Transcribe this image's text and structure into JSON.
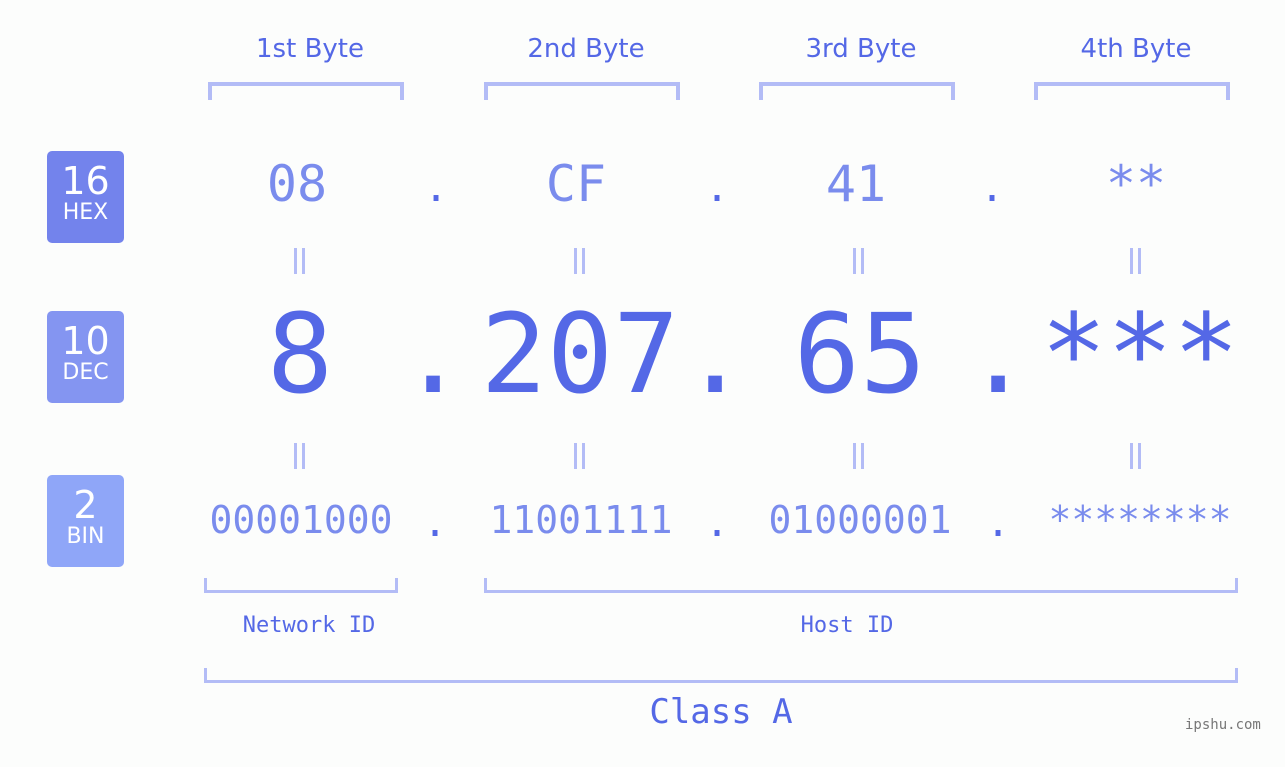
{
  "bytes": [
    {
      "label": "1st Byte",
      "hex": "08",
      "dec": "8",
      "bin": "00001000"
    },
    {
      "label": "2nd Byte",
      "hex": "CF",
      "dec": "207",
      "bin": "11001111"
    },
    {
      "label": "3rd Byte",
      "hex": "41",
      "dec": "65",
      "bin": "01000001"
    },
    {
      "label": "4th Byte",
      "hex": "**",
      "dec": "***",
      "bin": "********"
    }
  ],
  "separator": ".",
  "badges": {
    "hex": {
      "num": "16",
      "label": "HEX",
      "color": "#7383ec"
    },
    "dec": {
      "num": "10",
      "label": "DEC",
      "color": "#8495f1"
    },
    "bin": {
      "num": "2",
      "label": "BIN",
      "color": "#8fa6f8"
    }
  },
  "network_id_label": "Network ID",
  "host_id_label": "Host ID",
  "class_label": "Class A",
  "watermark": "ipshu.com",
  "colors": {
    "accent": "#5468e6",
    "light": "#7a8ced",
    "bracket": "#b3bcf6"
  }
}
